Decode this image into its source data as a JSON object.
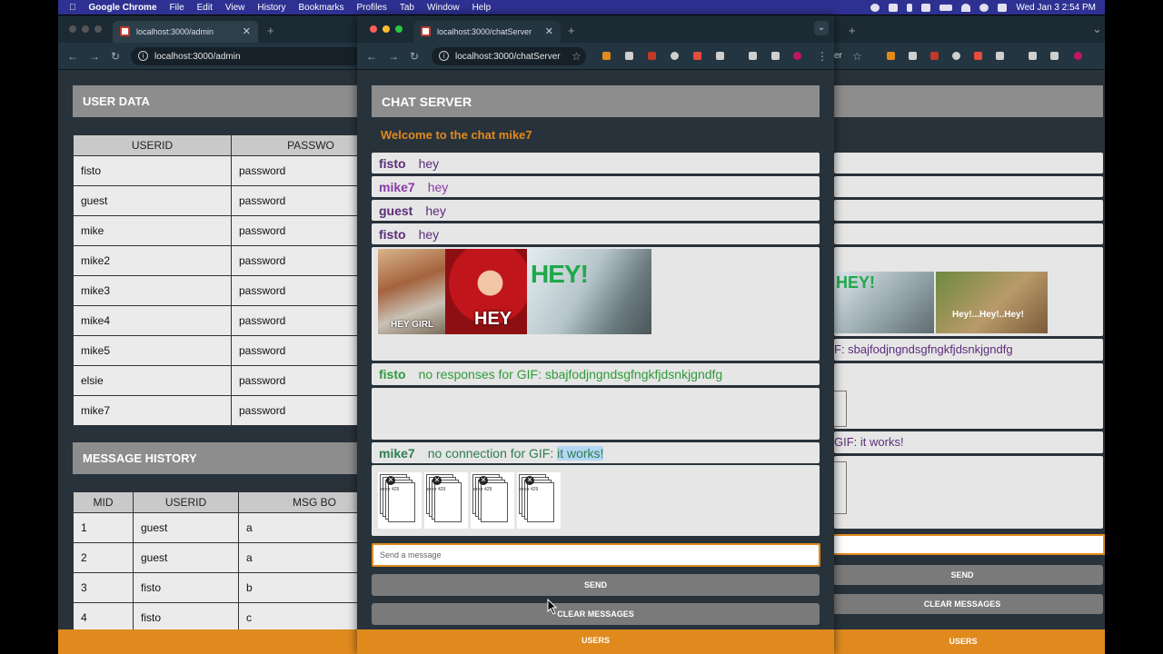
{
  "menubar": {
    "items": [
      "Google Chrome",
      "File",
      "Edit",
      "View",
      "History",
      "Bookmarks",
      "Profiles",
      "Tab",
      "Window",
      "Help"
    ],
    "clock": "Wed Jan 3  2:54 PM"
  },
  "admin_window": {
    "tab_title": "localhost:3000/admin",
    "url": "localhost:3000/admin",
    "user_data_title": "USER DATA",
    "user_columns": [
      "USERID",
      "PASSWO"
    ],
    "users": [
      [
        "fisto",
        "password"
      ],
      [
        "guest",
        "password"
      ],
      [
        "mike",
        "password"
      ],
      [
        "mike2",
        "password"
      ],
      [
        "mike3",
        "password"
      ],
      [
        "mike4",
        "password"
      ],
      [
        "mike5",
        "password"
      ],
      [
        "elsie",
        "password"
      ],
      [
        "mike7",
        "password"
      ]
    ],
    "message_history_title": "MESSAGE HISTORY",
    "history_columns": [
      "MID",
      "USERID",
      "MSG BO"
    ],
    "history": [
      [
        "1",
        "guest",
        "a"
      ],
      [
        "2",
        "guest",
        "a"
      ],
      [
        "3",
        "fisto",
        "b"
      ],
      [
        "4",
        "fisto",
        "c"
      ]
    ]
  },
  "chat_window": {
    "tab_title": "localhost:3000/chatServer",
    "url": "localhost:3000/chatServer",
    "header": "CHAT SERVER",
    "welcome": "Welcome to the chat mike7",
    "messages": [
      {
        "user": "fisto",
        "text": "hey"
      },
      {
        "user": "mike7",
        "text": "hey"
      },
      {
        "user": "guest",
        "text": "hey"
      },
      {
        "user": "fisto",
        "text": "hey"
      }
    ],
    "gif_labels": [
      "HEY GIRL",
      "HEY",
      "HEY!"
    ],
    "no_responses": {
      "user": "fisto",
      "text": "no responses for GIF: sbajfodjngndsgfngkfjdsnkjgndfg"
    },
    "no_connection": {
      "user": "mike7",
      "text_prefix": "no connection for GIF: ",
      "highlight": "it works!"
    },
    "error_tiles": [
      "error 429",
      "error 429",
      "error 429",
      "error 429"
    ],
    "input_placeholder": "Send a message",
    "send_label": "SEND",
    "clear_label": "CLEAR MESSAGES",
    "users_label": "USERS"
  },
  "right_window": {
    "url_fragment": "er",
    "gif_labels": [
      "HEY!",
      "Hey!...Hey!..Hey!"
    ],
    "no_responses_fragment": "F: sbajfodjngndsgfngkfjdsnkjgndfg",
    "no_connection_fragment": "GIF: it works!",
    "send_label": "SEND",
    "clear_label": "CLEAR MESSAGES",
    "users_label": "USERS"
  },
  "colors": {
    "page_bg": "#28323b",
    "header_gray": "#8d8d8d",
    "welcome_orange": "#e08a1e",
    "username_purple": "#5b2d7a",
    "gif_miss_green": "#2e9b3a",
    "bottom_bar_orange": "#e08a1e"
  }
}
